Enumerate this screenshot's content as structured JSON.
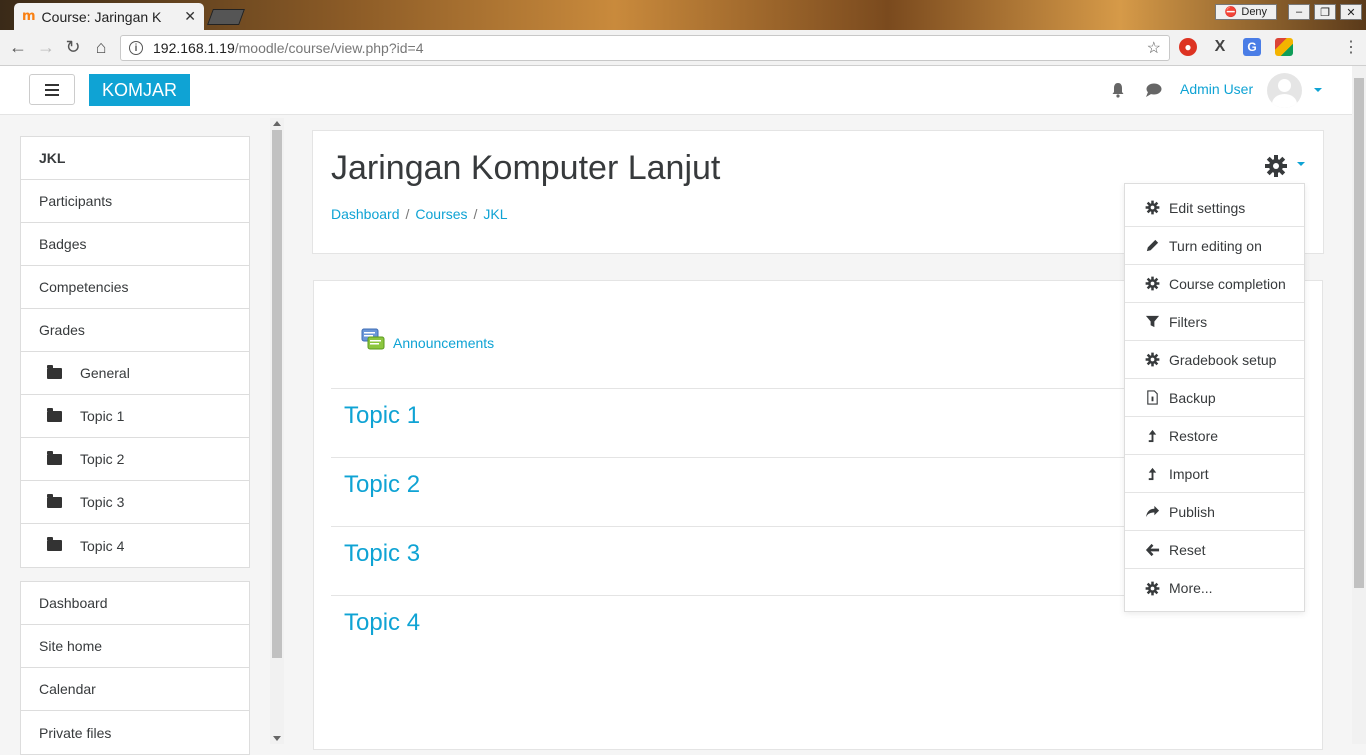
{
  "browser": {
    "tab_title": "Course: Jaringan K",
    "tab_favicon": "m",
    "url_host": "192.168.1.19",
    "url_path": "/moodle/course/view.php?id=4",
    "deny_label": "Deny"
  },
  "header": {
    "brand": "KOMJAR",
    "user_name": "Admin User",
    "accent_color": "#0fa3d4"
  },
  "drawer": {
    "course_items": [
      {
        "label": "JKL",
        "icon": ""
      },
      {
        "label": "Participants",
        "icon": ""
      },
      {
        "label": "Badges",
        "icon": ""
      },
      {
        "label": "Competencies",
        "icon": ""
      },
      {
        "label": "Grades",
        "icon": ""
      },
      {
        "label": "General",
        "icon": "folder-icon"
      },
      {
        "label": "Topic 1",
        "icon": "folder-icon"
      },
      {
        "label": "Topic 2",
        "icon": "folder-icon"
      },
      {
        "label": "Topic 3",
        "icon": "folder-icon"
      },
      {
        "label": "Topic 4",
        "icon": "folder-icon"
      }
    ],
    "site_items": [
      {
        "label": "Dashboard"
      },
      {
        "label": "Site home"
      },
      {
        "label": "Calendar"
      },
      {
        "label": "Private files"
      }
    ]
  },
  "course": {
    "title": "Jaringan Komputer Lanjut",
    "breadcrumb": [
      "Dashboard",
      "Courses",
      "JKL"
    ],
    "announcements_label": "Announcements",
    "topics": [
      "Topic 1",
      "Topic 2",
      "Topic 3",
      "Topic 4"
    ]
  },
  "actions_menu": [
    {
      "label": "Edit settings",
      "icon": "gear-icon"
    },
    {
      "label": "Turn editing on",
      "icon": "pencil-icon"
    },
    {
      "label": "Course completion",
      "icon": "gear-icon"
    },
    {
      "label": "Filters",
      "icon": "filter-icon"
    },
    {
      "label": "Gradebook setup",
      "icon": "gear-icon"
    },
    {
      "label": "Backup",
      "icon": "file-icon"
    },
    {
      "label": "Restore",
      "icon": "upload-icon"
    },
    {
      "label": "Import",
      "icon": "upload-icon"
    },
    {
      "label": "Publish",
      "icon": "share-icon"
    },
    {
      "label": "Reset",
      "icon": "arrow-left-icon"
    },
    {
      "label": "More...",
      "icon": "gear-icon"
    }
  ]
}
